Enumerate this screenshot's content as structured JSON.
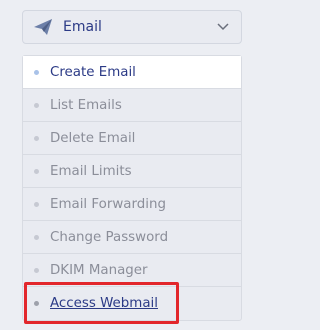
{
  "panel": {
    "title": "Email",
    "icon": "paper-plane-icon"
  },
  "menu": {
    "items": [
      {
        "label": "Create Email"
      },
      {
        "label": "List Emails"
      },
      {
        "label": "Delete Email"
      },
      {
        "label": "Email Limits"
      },
      {
        "label": "Email Forwarding"
      },
      {
        "label": "Change Password"
      },
      {
        "label": "DKIM Manager"
      },
      {
        "label": "Access Webmail"
      }
    ]
  },
  "colors": {
    "accent": "#2b3a86",
    "highlight_box": "#e2262b",
    "muted_text": "#8b8e99"
  }
}
